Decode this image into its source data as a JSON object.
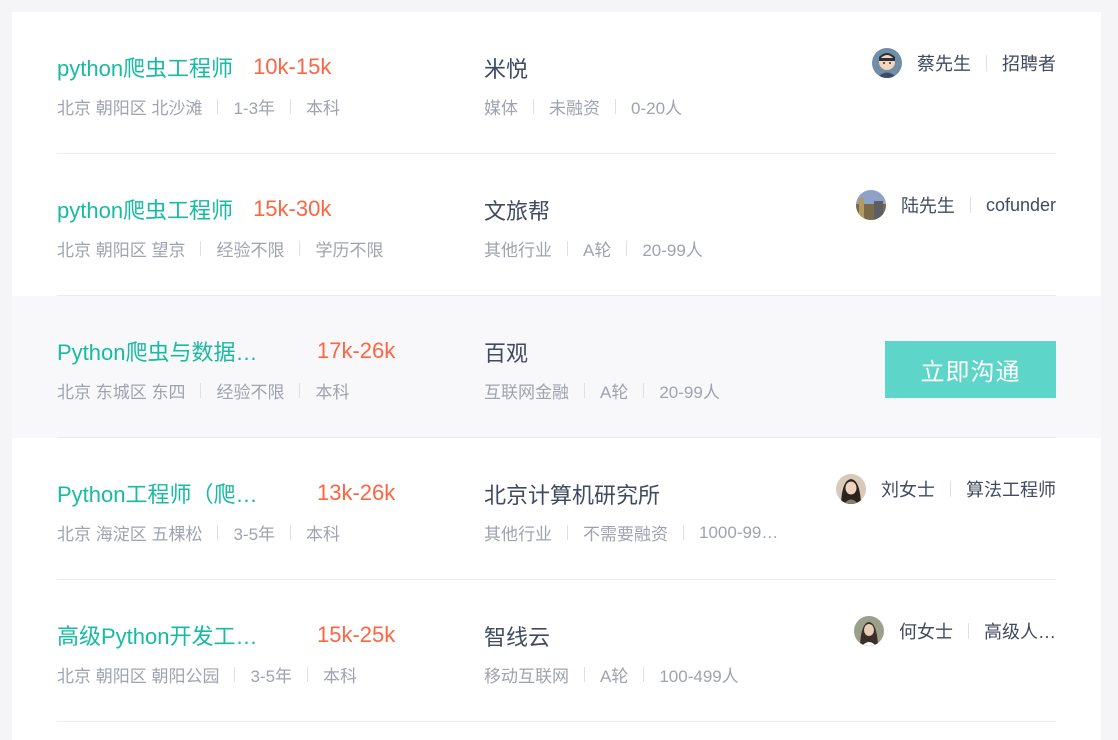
{
  "jobs": [
    {
      "title": "python爬虫工程师",
      "salary": "10k-15k",
      "location": "北京 朝阳区 北沙滩",
      "experience": "1-3年",
      "education": "本科",
      "company": "米悦",
      "industry": "媒体",
      "funding": "未融资",
      "size": "0-20人",
      "recruiter_name": "蔡先生",
      "recruiter_title": "招聘者",
      "avatar": "cartoon-man-avatar"
    },
    {
      "title": "python爬虫工程师",
      "salary": "15k-30k",
      "location": "北京 朝阳区 望京",
      "experience": "经验不限",
      "education": "学历不限",
      "company": "文旅帮",
      "industry": "其他行业",
      "funding": "A轮",
      "size": "20-99人",
      "recruiter_name": "陆先生",
      "recruiter_title": "cofunder",
      "avatar": "landscape-photo-avatar"
    },
    {
      "title": "Python爬虫与数据…",
      "salary": "17k-26k",
      "location": "北京 东城区 东四",
      "experience": "经验不限",
      "education": "本科",
      "company": "百观",
      "industry": "互联网金融",
      "funding": "A轮",
      "size": "20-99人",
      "action_label": "立即沟通"
    },
    {
      "title": "Python工程师（爬…",
      "salary": "13k-26k",
      "location": "北京 海淀区 五棵松",
      "experience": "3-5年",
      "education": "本科",
      "company": "北京计算机研究所",
      "industry": "其他行业",
      "funding": "不需要融资",
      "size": "1000-99…",
      "recruiter_name": "刘女士",
      "recruiter_title": "算法工程师",
      "avatar": "woman-photo-avatar"
    },
    {
      "title": "高级Python开发工…",
      "salary": "15k-25k",
      "location": "北京 朝阳区 朝阳公园",
      "experience": "3-5年",
      "education": "本科",
      "company": "智线云",
      "industry": "移动互联网",
      "funding": "A轮",
      "size": "100-499人",
      "recruiter_name": "何女士",
      "recruiter_title": "高级人…",
      "avatar": "woman-photo-avatar"
    }
  ],
  "colors": {
    "job_title": "#16bba1",
    "salary": "#fd6543",
    "meta": "#9fa3b0",
    "button": "#5dd5c8"
  }
}
